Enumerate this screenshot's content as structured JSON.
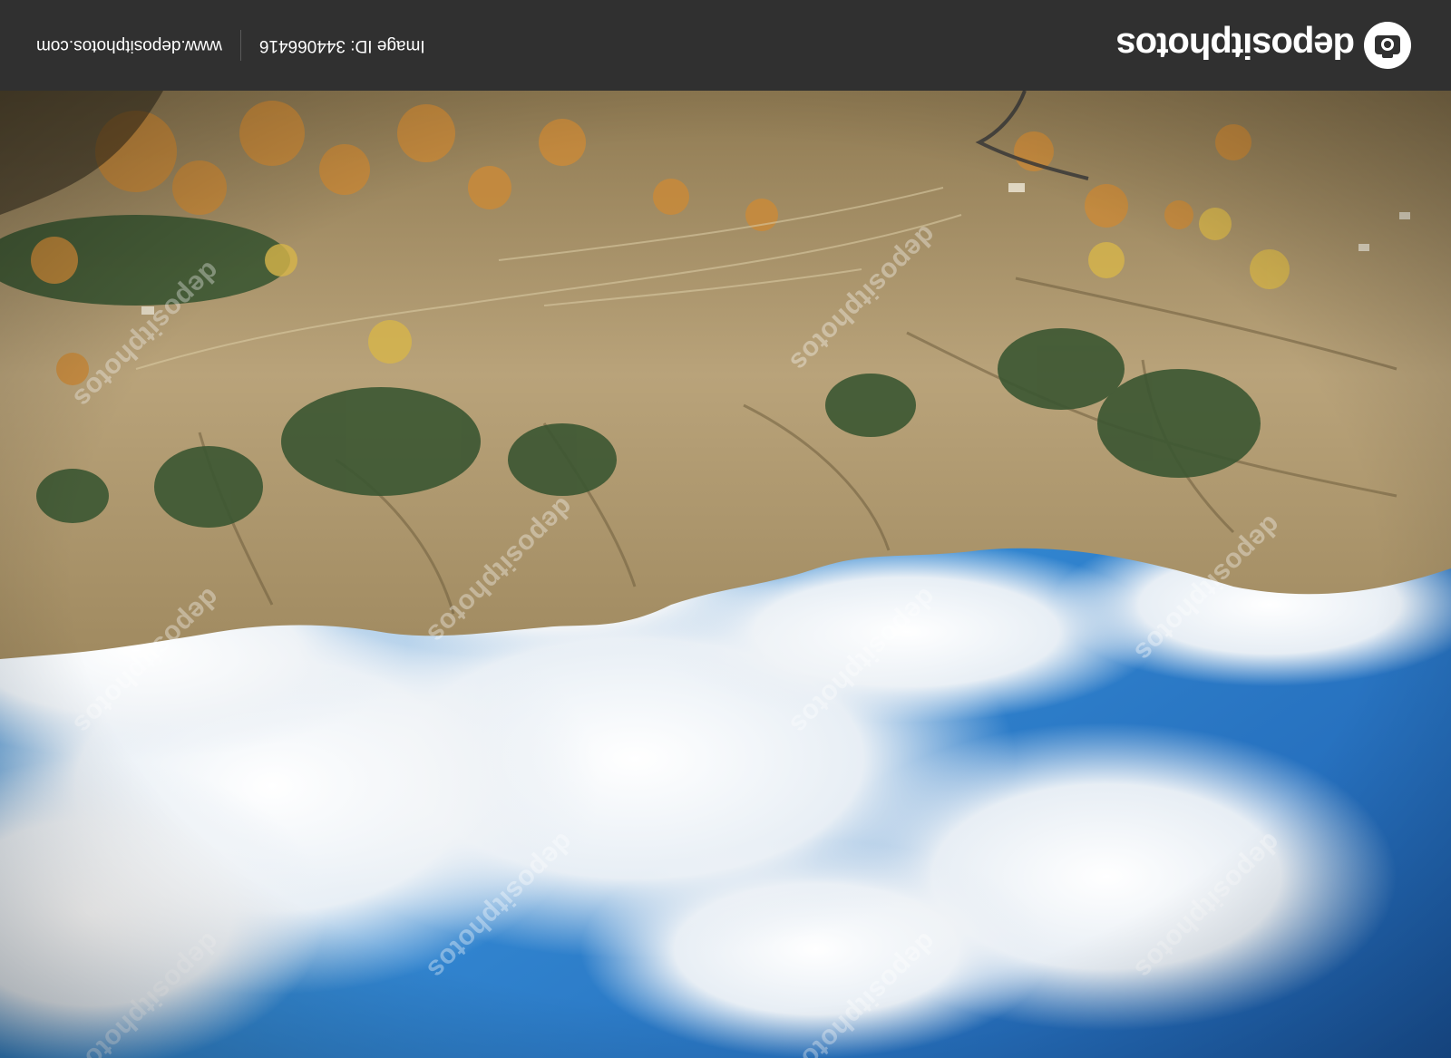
{
  "photo": {
    "description_icon": "landscape-photo",
    "watermark_text": "depositphotos",
    "colors": {
      "sky_blue": "#2f7fc9",
      "cloud_white": "#f2f5f8",
      "mountain_tan": "#b39c72",
      "trees_green": "#3d5b33",
      "autumn_orange": "#c98a3a"
    }
  },
  "branding": {
    "logo_text": "depositphotos",
    "logo_icon": "camera-icon",
    "image_id_label": "Image ID: 344066416",
    "site_url": "www.depositphotos.com",
    "bar_color": "#303030"
  }
}
